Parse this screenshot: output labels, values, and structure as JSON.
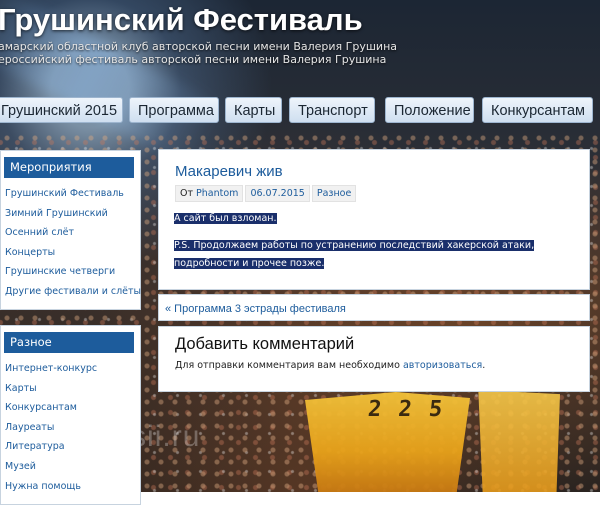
{
  "header": {
    "title": "Грушинский Фестиваль",
    "tagline_1": "амарский областной клуб авторской песни имени Валерия Грушина",
    "tagline_2": "ероссийский фестиваль авторской песни имени Валерия Грушина"
  },
  "nav": {
    "tabs": [
      {
        "label": "Грушинский 2015"
      },
      {
        "label": "Программа"
      },
      {
        "label": "Карты"
      },
      {
        "label": "Транспорт"
      },
      {
        "label": "Положение"
      },
      {
        "label": "Конкурсантам"
      }
    ]
  },
  "sidebar": {
    "events": {
      "heading": "Мероприятия",
      "items": [
        "Грушинский Фестиваль",
        "Зимний Грушинский",
        "Осенний слёт",
        "Концерты",
        "Грушинские четверги",
        "Другие фестивали и слёты"
      ]
    },
    "misc": {
      "heading": "Разное",
      "items": [
        "Интернет-конкурс",
        "Карты",
        "Конкурсантам",
        "Лауреаты",
        "Литература",
        "Музей",
        "Нужна помощь"
      ]
    }
  },
  "post": {
    "title": "Макаревич жив",
    "meta_by": "От",
    "author": "Phantom",
    "date": "06.07.2015",
    "category": "Разное",
    "p1": "А сайт был взломан.",
    "p2": "P.S. Продолжаем работы по устранению последствий хакерской атаки, подробности и прочее позже."
  },
  "prev_link": "« Программа 3 эстрады фестиваля",
  "comments": {
    "title": "Добавить комментарий",
    "note_text": "Для отправки комментария вам необходимо",
    "note_link": "авторизоваться",
    "note_end": "."
  },
  "photo": {
    "sail_number": "2 2 5",
    "watermark": "A vRossii.ru"
  }
}
